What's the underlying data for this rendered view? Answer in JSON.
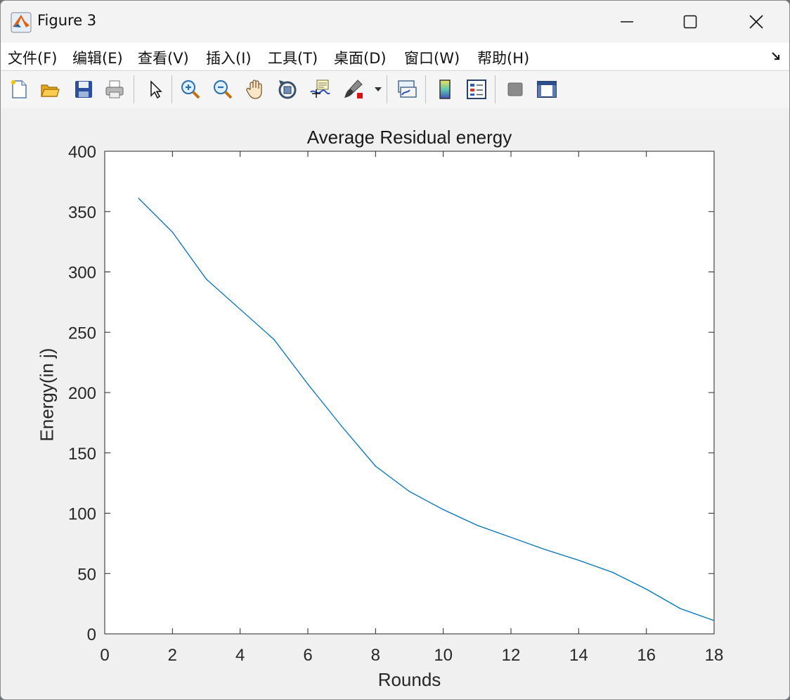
{
  "window": {
    "title": "Figure 3",
    "controls": [
      "minimize-icon",
      "maximize-icon",
      "close-icon"
    ]
  },
  "menu": {
    "items": [
      {
        "label": "文件(F)"
      },
      {
        "label": "编辑(E)"
      },
      {
        "label": "查看(V)"
      },
      {
        "label": "插入(I)"
      },
      {
        "label": "工具(T)"
      },
      {
        "label": "桌面(D)"
      },
      {
        "label": "窗口(W)"
      },
      {
        "label": "帮助(H)"
      }
    ]
  },
  "toolbar": {
    "icons": [
      "new-figure-icon",
      "open-file-icon",
      "save-icon",
      "print-icon",
      "select-arrow-icon",
      "zoom-in-icon",
      "zoom-out-icon",
      "pan-hand-icon",
      "rotate-3d-icon",
      "data-cursor-icon",
      "brush-icon",
      "brush-dropdown-icon",
      "link-plot-icon",
      "colorbar-icon",
      "legend-icon",
      "hide-plot-tools-icon",
      "show-plot-tools-icon"
    ]
  },
  "colors": {
    "line": "#0072bd",
    "axes_bg": "#ffffff",
    "figure_bg": "#f0f0f0",
    "axis": "#262626"
  },
  "chart_data": {
    "type": "line",
    "title": "Average Residual energy",
    "xlabel": "Rounds",
    "ylabel": "Energy(in j)",
    "xlim": [
      0,
      18
    ],
    "ylim": [
      0,
      400
    ],
    "xticks": [
      0,
      2,
      4,
      6,
      8,
      10,
      12,
      14,
      16,
      18
    ],
    "yticks": [
      0,
      50,
      100,
      150,
      200,
      250,
      300,
      350,
      400
    ],
    "grid": false,
    "series": [
      {
        "x": [
          1,
          2,
          3,
          4,
          5,
          6,
          7,
          8,
          9,
          10,
          11,
          12,
          13,
          14,
          15,
          16,
          17,
          18
        ],
        "y": [
          361,
          333,
          294,
          269,
          244,
          207,
          172,
          139,
          118,
          103,
          90,
          80,
          70,
          61,
          51,
          37,
          21,
          11
        ]
      }
    ]
  }
}
